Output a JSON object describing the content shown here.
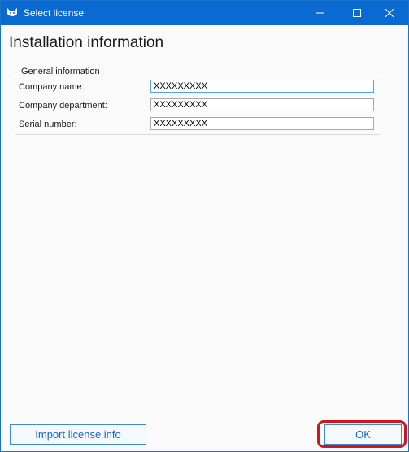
{
  "window": {
    "title": "Select license",
    "accent": "#0a6ad1",
    "icon": "cat-logo-icon"
  },
  "titlebar_buttons": {
    "minimize_icon": "minimize-icon",
    "maximize_icon": "maximize-icon",
    "close_icon": "close-icon"
  },
  "heading": "Installation information",
  "general_info": {
    "legend": "General information",
    "fields": [
      {
        "label": "Company name:",
        "value": "XXXXXXXXX"
      },
      {
        "label": "Company department:",
        "value": "XXXXXXXXX"
      },
      {
        "label": "Serial number:",
        "value": "XXXXXXXXX"
      }
    ]
  },
  "buttons": {
    "import_label": "Import license info",
    "ok_label": "OK"
  },
  "highlight_color": "#d4141c"
}
